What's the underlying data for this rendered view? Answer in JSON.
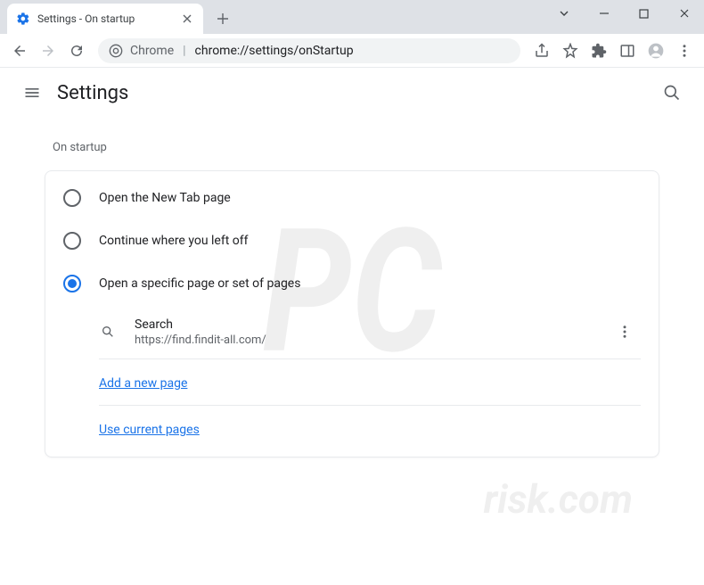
{
  "tab": {
    "title": "Settings - On startup"
  },
  "omnibox": {
    "scheme": "Chrome",
    "url": "chrome://settings/onStartup"
  },
  "app": {
    "title": "Settings"
  },
  "section": {
    "label": "On startup"
  },
  "options": {
    "new_tab": "Open the New Tab page",
    "continue": "Continue where you left off",
    "specific": "Open a specific page or set of pages"
  },
  "startup_page": {
    "title": "Search",
    "url": "https://find.findit-all.com/"
  },
  "links": {
    "add": "Add a new page",
    "use_current": "Use current pages"
  }
}
